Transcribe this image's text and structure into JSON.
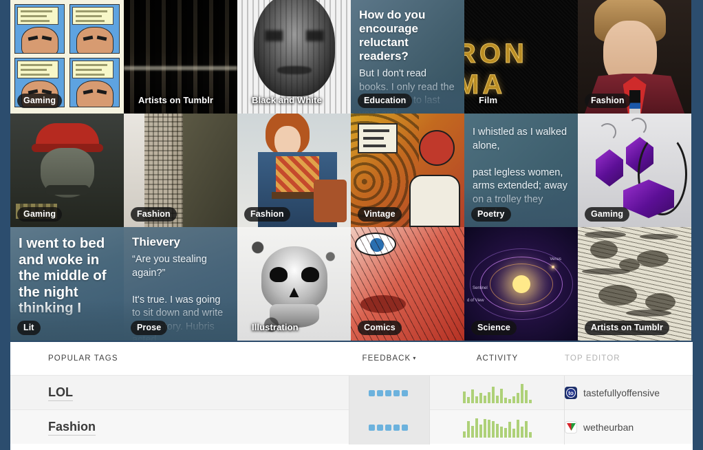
{
  "theme": {
    "page_background": "#2c4d6e",
    "panel_background": "#ffffff",
    "feedback_color": "#6cb2dd",
    "activity_color": "#aed178",
    "label_pill_background": "rgba(18,18,18,0.82)"
  },
  "grid": {
    "rows": [
      [
        {
          "label": "Gaming",
          "label_style": "pill",
          "art": "comic"
        },
        {
          "label": "Artists on Tumblr",
          "label_style": "plain",
          "art": "forest"
        },
        {
          "label": "Black and White",
          "label_style": "plain",
          "art": "bw"
        },
        {
          "label": "Education",
          "label_style": "pill",
          "art": "text",
          "title": "How do you encourage reluctant readers?",
          "body": "But I don't read books. I only read the books I had to last year and",
          "bg": "bg-edu"
        },
        {
          "label": "Film",
          "label_style": "plain",
          "art": "ironman",
          "art_text": "RON MA"
        },
        {
          "label": "Fashion",
          "label_style": "pill",
          "art": "fashion1"
        }
      ],
      [
        {
          "label": "Gaming",
          "label_style": "pill",
          "art": "mariodark"
        },
        {
          "label": "Fashion",
          "label_style": "pill",
          "art": "fashion2"
        },
        {
          "label": "Fashion",
          "label_style": "pill",
          "art": "fashion3"
        },
        {
          "label": "Vintage",
          "label_style": "pill",
          "art": "vintage"
        },
        {
          "label": "Poetry",
          "label_style": "pill",
          "art": "text",
          "title": "",
          "body": "I whistled as I walked alone,\n\npast legless women, arms extended; away on a trolley they rolled\n\npast muscular men,",
          "bg": "bg-poetry"
        },
        {
          "label": "Gaming",
          "label_style": "pill",
          "art": "jewel"
        }
      ],
      [
        {
          "label": "Lit",
          "label_style": "pill",
          "art": "text",
          "title": "I went to bed and woke in the middle of the night thinking I",
          "body": "",
          "bg": "bg-lit",
          "title_size": "big"
        },
        {
          "label": "Prose",
          "label_style": "pill",
          "art": "text",
          "title": "Thievery",
          "body": "“Are you stealing again?”\n\n It's true. I was going to sit down and write a war story. Hubris acted",
          "bg": "bg-prose"
        },
        {
          "label": "Illustration",
          "label_style": "plain",
          "art": "skull"
        },
        {
          "label": "Comics",
          "label_style": "pill",
          "art": "comics"
        },
        {
          "label": "Science",
          "label_style": "pill",
          "art": "space",
          "art_text_1": "Venus",
          "art_text_2": "Sentinel",
          "art_text_3": "d of View"
        },
        {
          "label": "Artists on Tumblr",
          "label_style": "pill",
          "art": "engrave"
        }
      ]
    ]
  },
  "table": {
    "headers": {
      "tags": "POPULAR TAGS",
      "feedback": "FEEDBACK",
      "feedback_caret": "▾",
      "activity": "ACTIVITY",
      "top_editor": "TOP EDITOR"
    },
    "rows": [
      {
        "tag": "LOL",
        "feedback": 5,
        "activity": [
          16,
          9,
          19,
          10,
          14,
          11,
          15,
          23,
          11,
          20,
          8,
          6,
          10,
          14,
          27,
          18,
          5
        ],
        "editor": "tastefullyoffensive",
        "avatar": "av-to"
      },
      {
        "tag": "Fashion",
        "feedback": 5,
        "activity": [
          8,
          22,
          16,
          26,
          18,
          25,
          24,
          22,
          19,
          15,
          13,
          21,
          12,
          24,
          15,
          22,
          7
        ],
        "editor": "wetheurban",
        "avatar": "av-we"
      }
    ]
  }
}
